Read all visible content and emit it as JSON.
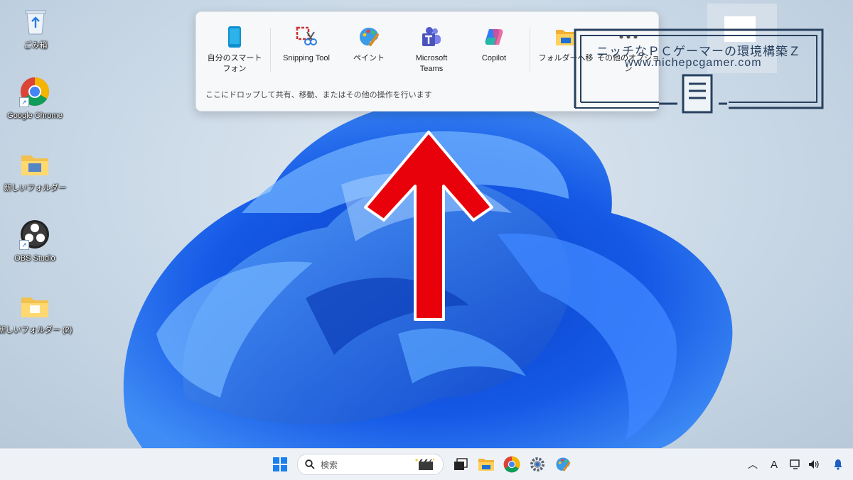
{
  "desktop_icons": [
    {
      "label": "ごみ箱",
      "icon": "recycle-bin-icon"
    },
    {
      "label": "Google Chrome",
      "icon": "chrome-icon"
    },
    {
      "label": "新しいフォルダー",
      "icon": "folder-icon"
    },
    {
      "label": "OBS Studio",
      "icon": "obs-icon"
    },
    {
      "label": "新しいフォルダー (2)",
      "icon": "folder-icon"
    }
  ],
  "share_panel": {
    "targets": [
      {
        "label": "自分のスマート\nフォン",
        "icon": "phone-icon"
      },
      {
        "label": "Snipping Tool",
        "icon": "snipping-tool-icon"
      },
      {
        "label": "ペイント",
        "icon": "paint-icon"
      },
      {
        "label": "Microsoft\nTeams",
        "icon": "teams-icon"
      },
      {
        "label": "Copilot",
        "icon": "copilot-icon"
      },
      {
        "label": "フォルダーへ移",
        "icon": "folder-icon"
      },
      {
        "label": "その他のオプショ\nン",
        "icon": "more-icon"
      }
    ],
    "hint": "ここにドロップして共有、移動、またはその他の操作を行います"
  },
  "watermark": {
    "line1": "ニッチなＰＣゲーマーの環境構築Ｚ",
    "line2": "www.nichepcgamer.com"
  },
  "taskbar": {
    "search_placeholder": "検索",
    "apps": [
      "start-icon",
      "task-view-icon",
      "file-explorer-icon",
      "chrome-icon",
      "settings-icon",
      "paint-icon"
    ],
    "tray": {
      "ime": "A"
    }
  },
  "colors": {
    "arrow": "#e8000b",
    "accent": "#0067c0",
    "wallpaper": "#1a5fe0"
  }
}
